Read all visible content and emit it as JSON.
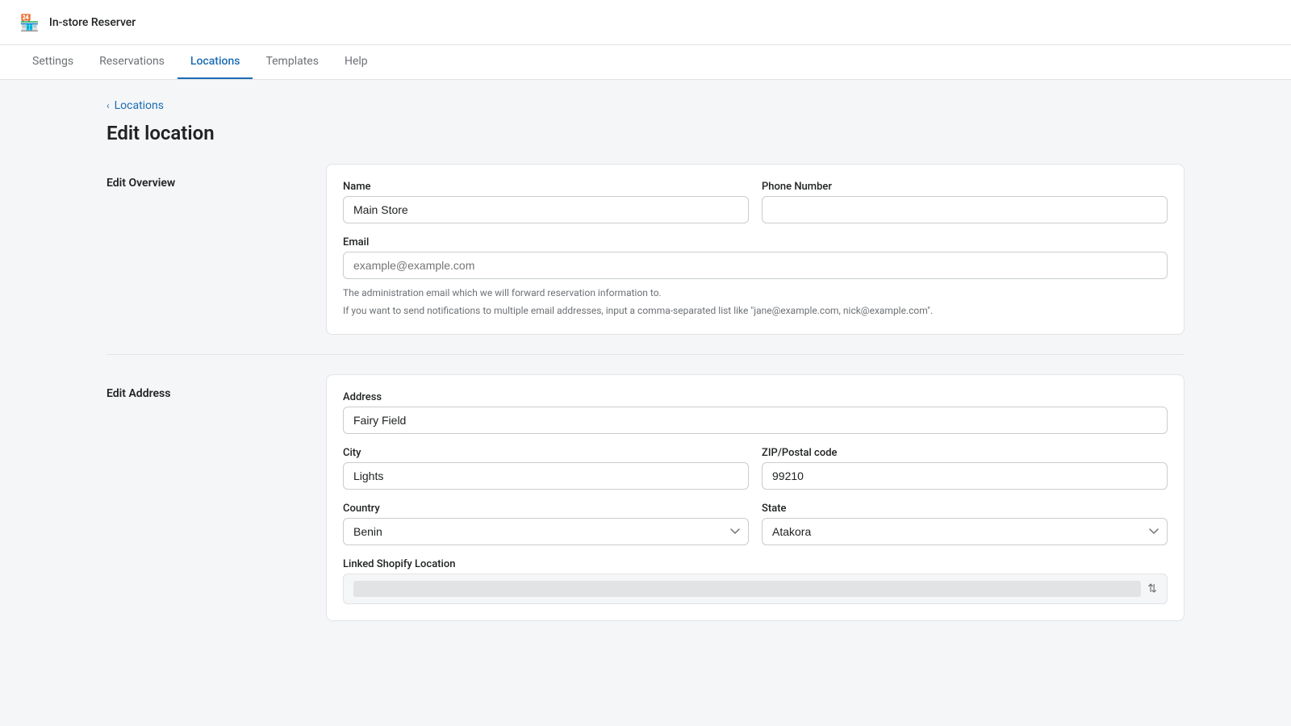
{
  "app": {
    "logo_icon": "🏪",
    "title": "In-store Reserver"
  },
  "nav": {
    "items": [
      {
        "id": "settings",
        "label": "Settings",
        "active": false
      },
      {
        "id": "reservations",
        "label": "Reservations",
        "active": false
      },
      {
        "id": "locations",
        "label": "Locations",
        "active": true
      },
      {
        "id": "templates",
        "label": "Templates",
        "active": false
      },
      {
        "id": "help",
        "label": "Help",
        "active": false
      }
    ]
  },
  "breadcrumb": {
    "back_label": "Locations"
  },
  "page": {
    "title": "Edit location"
  },
  "edit_overview": {
    "section_label": "Edit Overview",
    "name_label": "Name",
    "name_value": "Main Store",
    "phone_label": "Phone Number",
    "phone_value": "",
    "email_label": "Email",
    "email_placeholder": "example@example.com",
    "email_value": "",
    "email_hint1": "The administration email which we will forward reservation information to.",
    "email_hint2": "If you want to send notifications to multiple email addresses, input a comma-separated list like \"jane@example.com, nick@example.com\"."
  },
  "edit_address": {
    "section_label": "Edit Address",
    "address_label": "Address",
    "address_value": "Fairy Field",
    "city_label": "City",
    "city_value": "Lights",
    "zip_label": "ZIP/Postal code",
    "zip_value": "99210",
    "country_label": "Country",
    "country_value": "Benin",
    "state_label": "State",
    "state_value": "Atakora",
    "linked_shopify_label": "Linked Shopify Location",
    "linked_shopify_value": ""
  }
}
